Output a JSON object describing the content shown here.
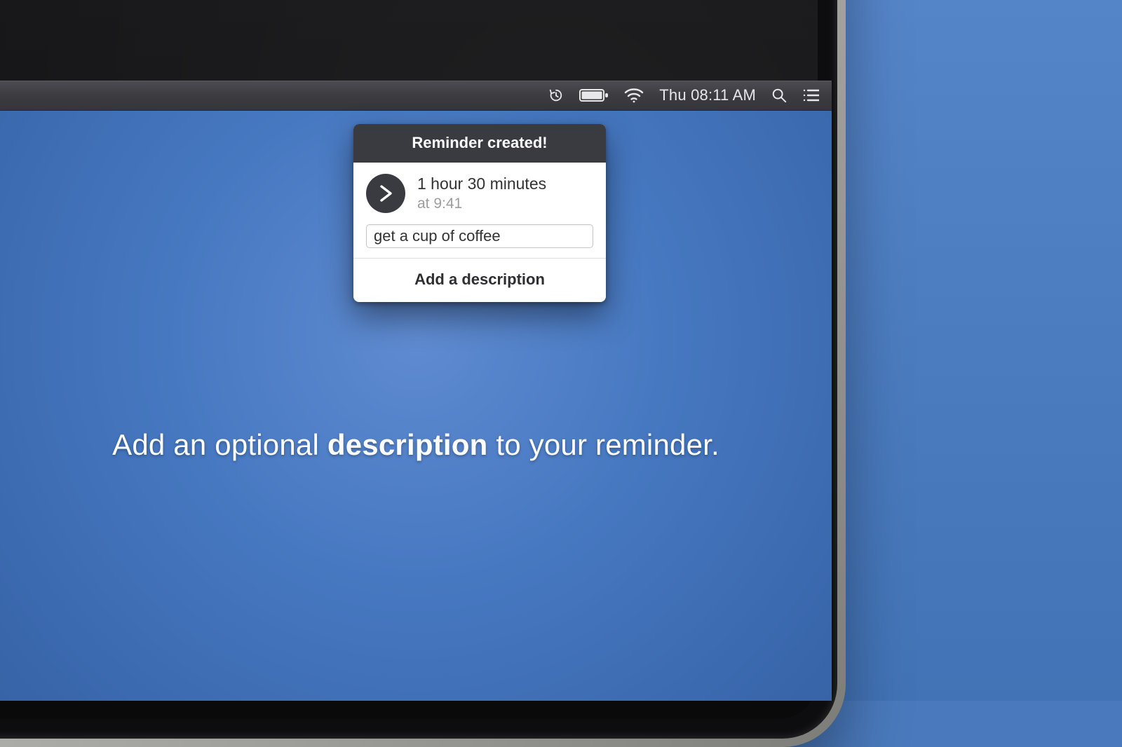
{
  "menubar": {
    "clock": "Thu 08:11 AM"
  },
  "popover": {
    "title": "Reminder created!",
    "icon": "chevron-right",
    "duration": "1 hour 30 minutes",
    "at_time": "at 9:41",
    "description_value": "get a cup of coffee",
    "footer_label": "Add a description"
  },
  "caption": {
    "pre": "Add an optional ",
    "emph": "description",
    "post": " to your reminder."
  }
}
